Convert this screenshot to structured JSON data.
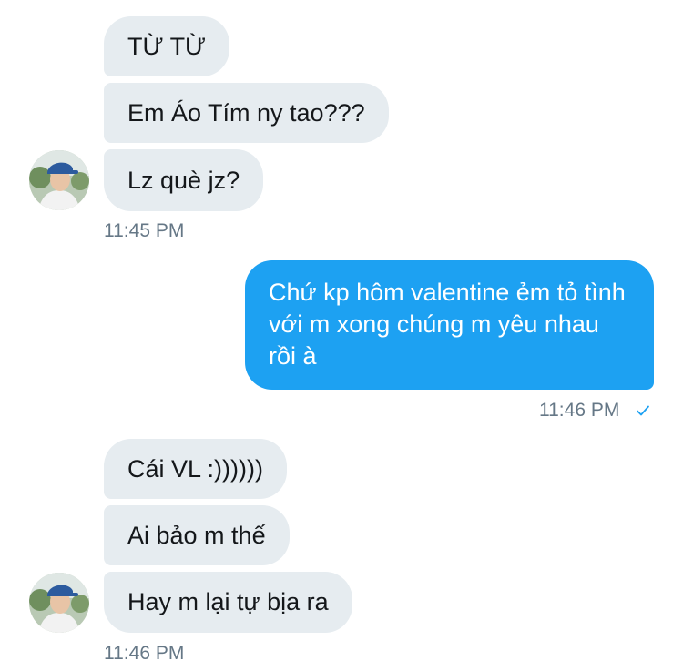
{
  "conversation": {
    "group1": {
      "messages": [
        "TỪ TỪ",
        "Em Áo Tím ny tao???",
        "Lz què jz?"
      ],
      "timestamp": "11:45 PM"
    },
    "outgoing": {
      "message": "Chứ kp hôm valentine ẻm tỏ tình với m xong chúng m yêu nhau rồi à",
      "timestamp": "11:46 PM"
    },
    "group2": {
      "messages": [
        "Cái VL :))))))",
        "Ai bảo m thế",
        "Hay m lại tự bịa ra"
      ],
      "timestamp": "11:46 PM"
    }
  },
  "colors": {
    "incoming_bubble": "#e6ecf0",
    "outgoing_bubble": "#1da1f2",
    "timestamp": "#657786",
    "read_check": "#1da1f2"
  },
  "icons": {
    "read_receipt": "checkmark-icon",
    "avatar": "user-avatar-photo"
  }
}
